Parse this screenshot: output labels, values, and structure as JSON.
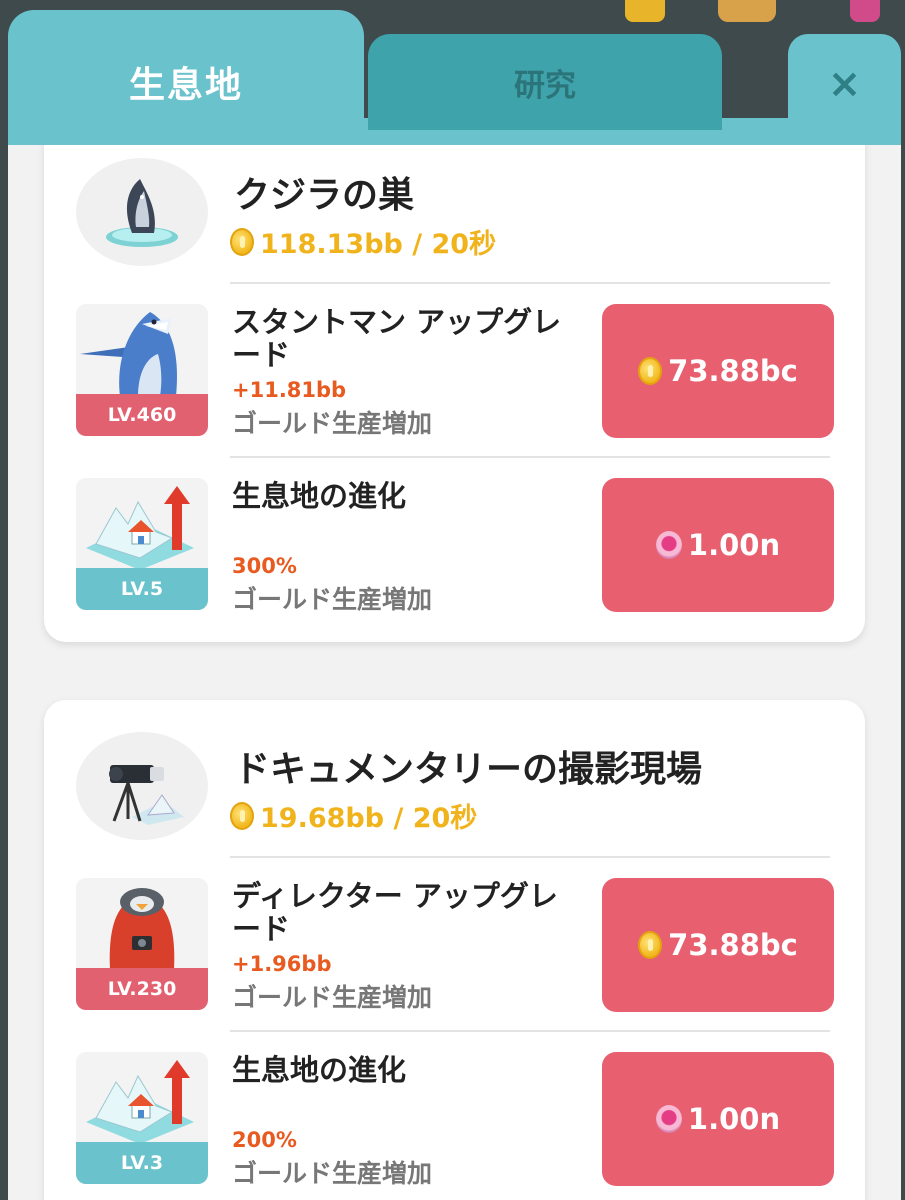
{
  "tabs": {
    "habitat_label": "生息地",
    "research_label": "研究",
    "close_label": "×"
  },
  "habitats": [
    {
      "name": "クジラの巣",
      "rate": "118.13bb / 20秒",
      "icon": "whale-nest-icon",
      "items": [
        {
          "title": "スタントマン アップグレード",
          "level": "LV.460",
          "bonus": "+11.81bb",
          "desc": "ゴールド生産増加",
          "price": "73.88bc",
          "currency": "gold-coin-icon",
          "icon": "shark-stuntman-icon"
        },
        {
          "title": "生息地の進化",
          "level": "LV.5",
          "bonus": "300%",
          "desc": "ゴールド生産増加",
          "price": "1.00n",
          "currency": "pink-gem-icon",
          "icon": "habitat-evolution-icon"
        }
      ]
    },
    {
      "name": "ドキュメンタリーの撮影現場",
      "rate": "19.68bb / 20秒",
      "icon": "camera-site-icon",
      "items": [
        {
          "title": "ディレクター アップグレード",
          "level": "LV.230",
          "bonus": "+1.96bb",
          "desc": "ゴールド生産増加",
          "price": "73.88bc",
          "currency": "gold-coin-icon",
          "icon": "penguin-director-icon"
        },
        {
          "title": "生息地の進化",
          "level": "LV.3",
          "bonus": "200%",
          "desc": "ゴールド生産増加",
          "price": "1.00n",
          "currency": "pink-gem-icon",
          "icon": "habitat-evolution-icon"
        }
      ]
    }
  ],
  "colors": {
    "tab_teal": "#6ac3cc",
    "tab_dark": "#3fa3ab",
    "button_red": "#e86070",
    "gold": "#f1b31c",
    "bonus_orange": "#e85a1f"
  }
}
